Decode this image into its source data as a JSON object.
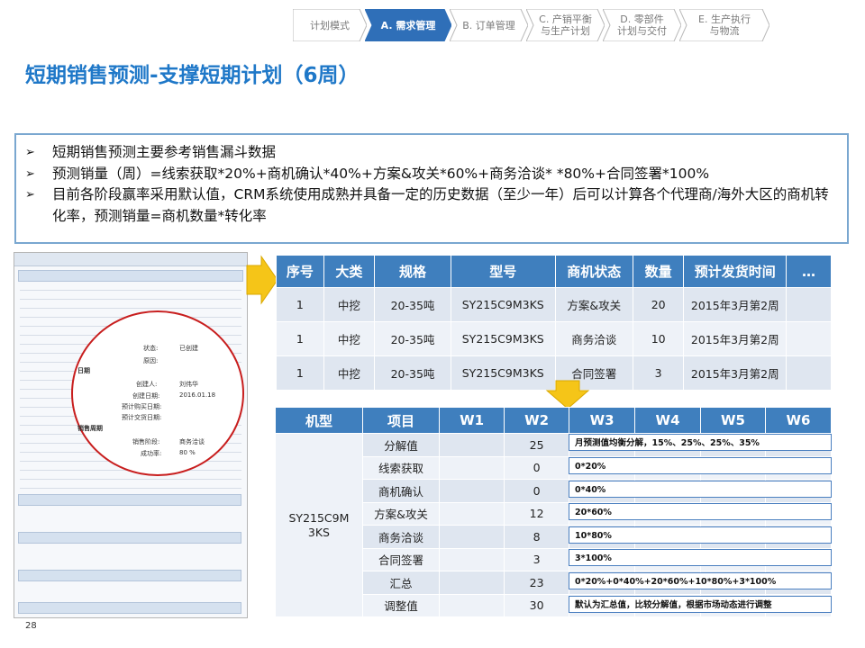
{
  "process": {
    "steps": [
      {
        "label": "计划模式",
        "active": false
      },
      {
        "label": "A. 需求管理",
        "active": true
      },
      {
        "label": "B. 订单管理",
        "active": false
      },
      {
        "label": "C. 产销平衡\n与生产计划",
        "active": false
      },
      {
        "label": "D. 零部件\n计划与交付",
        "active": false
      },
      {
        "label": "E. 生产执行\n与物流",
        "active": false
      }
    ]
  },
  "title": "短期销售预测-支撑短期计划（6周）",
  "bullets": [
    "短期销售预测主要参考销售漏斗数据",
    "预测销量（周）=线索获取*20%+商机确认*40%+方案&攻关*60%+商务洽谈* *80%+合同签署*100%",
    "目前各阶段赢率采用默认值，CRM系统使用成熟并具备一定的历史数据（至少一年）后可以计算各个代理商/海外大区的商机转化率，预测销量=商机数量*转化率"
  ],
  "thumbnail": {
    "fields": [
      {
        "label": "状态:",
        "value": "已创建"
      },
      {
        "label": "原因:",
        "value": ""
      },
      {
        "label": "创建人:",
        "value": "刘伟华"
      },
      {
        "label": "创建日期:",
        "value": "2016.01.18"
      },
      {
        "label": "预计购买日期:",
        "value": ""
      },
      {
        "label": "预计交货日期:",
        "value": ""
      },
      {
        "label": "销售阶段:",
        "value": "商务洽谈"
      },
      {
        "label": "成功率:",
        "value": "80          %"
      }
    ],
    "section_date": "日期",
    "section_cycle": "销售周期"
  },
  "opportunity_table": {
    "headers": [
      "序号",
      "大类",
      "规格",
      "型号",
      "商机状态",
      "数量",
      "预计发货时间",
      "…"
    ],
    "rows": [
      [
        "1",
        "中挖",
        "20-35吨",
        "SY215C9M3KS",
        "方案&攻关",
        "20",
        "2015年3月第2周",
        ""
      ],
      [
        "1",
        "中挖",
        "20-35吨",
        "SY215C9M3KS",
        "商务洽谈",
        "10",
        "2015年3月第2周",
        ""
      ],
      [
        "1",
        "中挖",
        "20-35吨",
        "SY215C9M3KS",
        "合同签署",
        "3",
        "2015年3月第2周",
        ""
      ]
    ]
  },
  "forecast_table": {
    "headers": [
      "机型",
      "项目",
      "W1",
      "W2",
      "W3",
      "W4",
      "W5",
      "W6"
    ],
    "model": "SY215C9M\n3KS",
    "rows": [
      {
        "item": "分解值",
        "w2": "25",
        "note": "月预测值均衡分解，15%、25%、25%、35%"
      },
      {
        "item": "线索获取",
        "w2": "0",
        "note": "0*20%"
      },
      {
        "item": "商机确认",
        "w2": "0",
        "note": "0*40%"
      },
      {
        "item": "方案&攻关",
        "w2": "12",
        "note": "20*60%"
      },
      {
        "item": "商务洽谈",
        "w2": "8",
        "note": "10*80%"
      },
      {
        "item": "合同签署",
        "w2": "3",
        "note": "3*100%"
      },
      {
        "item": "汇总",
        "w2": "23",
        "note": "0*20%+0*40%+20*60%+10*80%+3*100%"
      },
      {
        "item": "调整值",
        "w2": "30",
        "note": "默认为汇总值，比较分解值，根据市场动态进行调整"
      }
    ]
  },
  "page_number": "28",
  "colors": {
    "accent": "#1f78c8",
    "header": "#3f7fbe",
    "active_step": "#2f6fb8",
    "circle": "#c81e1e",
    "arrow": "#f5c518"
  }
}
